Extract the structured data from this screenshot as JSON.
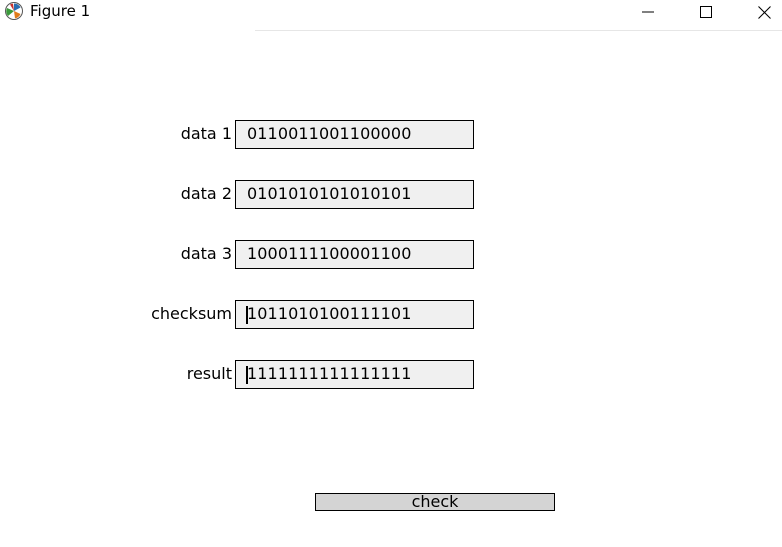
{
  "window": {
    "title": "Figure 1",
    "icon": "matplotlib-logo-icon",
    "controls": [
      "minimize-icon",
      "maximize-icon",
      "close-icon"
    ]
  },
  "form": {
    "fields": [
      {
        "label": "data 1",
        "value": "0110011001100000",
        "focused": false
      },
      {
        "label": "data 2",
        "value": "0101010101010101",
        "focused": false
      },
      {
        "label": "data 3",
        "value": "1000111100001100",
        "focused": false
      },
      {
        "label": "checksum",
        "value": "1011010100111101",
        "focused": true
      },
      {
        "label": "result",
        "value": "1111111111111111",
        "focused": true
      }
    ],
    "check_label": "check"
  },
  "colors": {
    "field_bg": "#f0f0f0",
    "button_bg": "#d4d4d4",
    "border": "#000000"
  }
}
